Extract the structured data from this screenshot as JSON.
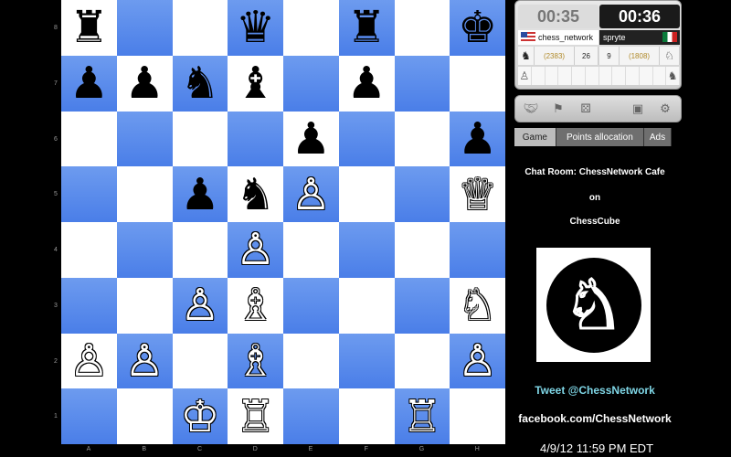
{
  "board": {
    "files": [
      "A",
      "B",
      "C",
      "D",
      "E",
      "F",
      "G",
      "H"
    ],
    "ranks": [
      "8",
      "7",
      "6",
      "5",
      "4",
      "3",
      "2",
      "1"
    ],
    "rows": [
      [
        "br",
        "",
        "",
        "bq",
        "",
        "br",
        "",
        "bk"
      ],
      [
        "bp",
        "bp",
        "bn",
        "bb",
        "",
        "bp",
        "",
        ""
      ],
      [
        "",
        "",
        "",
        "",
        "bp",
        "",
        "",
        "bp"
      ],
      [
        "",
        "",
        "bp",
        "bn",
        "wp",
        "",
        "",
        "wq"
      ],
      [
        "",
        "",
        "",
        "wp",
        "",
        "",
        "",
        ""
      ],
      [
        "",
        "",
        "wp",
        "wb",
        "",
        "",
        "",
        "wn"
      ],
      [
        "wp",
        "wp",
        "",
        "wb",
        "",
        "",
        "",
        "wp"
      ],
      [
        "",
        "",
        "wk",
        "wr",
        "",
        "",
        "wr",
        ""
      ]
    ]
  },
  "clock": {
    "left_time": "00:35",
    "right_time": "00:36"
  },
  "players": {
    "left": {
      "name": "chess_network",
      "rating": "(2383)",
      "moves": "26"
    },
    "right": {
      "name": "spryte",
      "rating": "(1808)",
      "moves": "9"
    }
  },
  "captured_icons": [
    "knight-white",
    "knight-black"
  ],
  "toolbar": {
    "icons": [
      "handshake-icon",
      "flag-icon",
      "dice-icon",
      "save-icon",
      "settings-icon"
    ]
  },
  "tabs": [
    {
      "label": "Game",
      "active": true
    },
    {
      "label": "Points allocation",
      "active": false
    },
    {
      "label": "Ads",
      "active": false
    }
  ],
  "sidebar": {
    "chat_room": "Chat Room: ChessNetwork Cafe",
    "on": "on",
    "site": "ChessCube",
    "tweet": "Tweet @ChessNetwork",
    "facebook": "facebook.com/ChessNetwork",
    "timestamp": "4/9/12 11:59 PM  EDT"
  },
  "colors": {
    "dark_square": "#5a8aec",
    "light_square": "#ffffff",
    "tweet": "#7fd6e6"
  }
}
